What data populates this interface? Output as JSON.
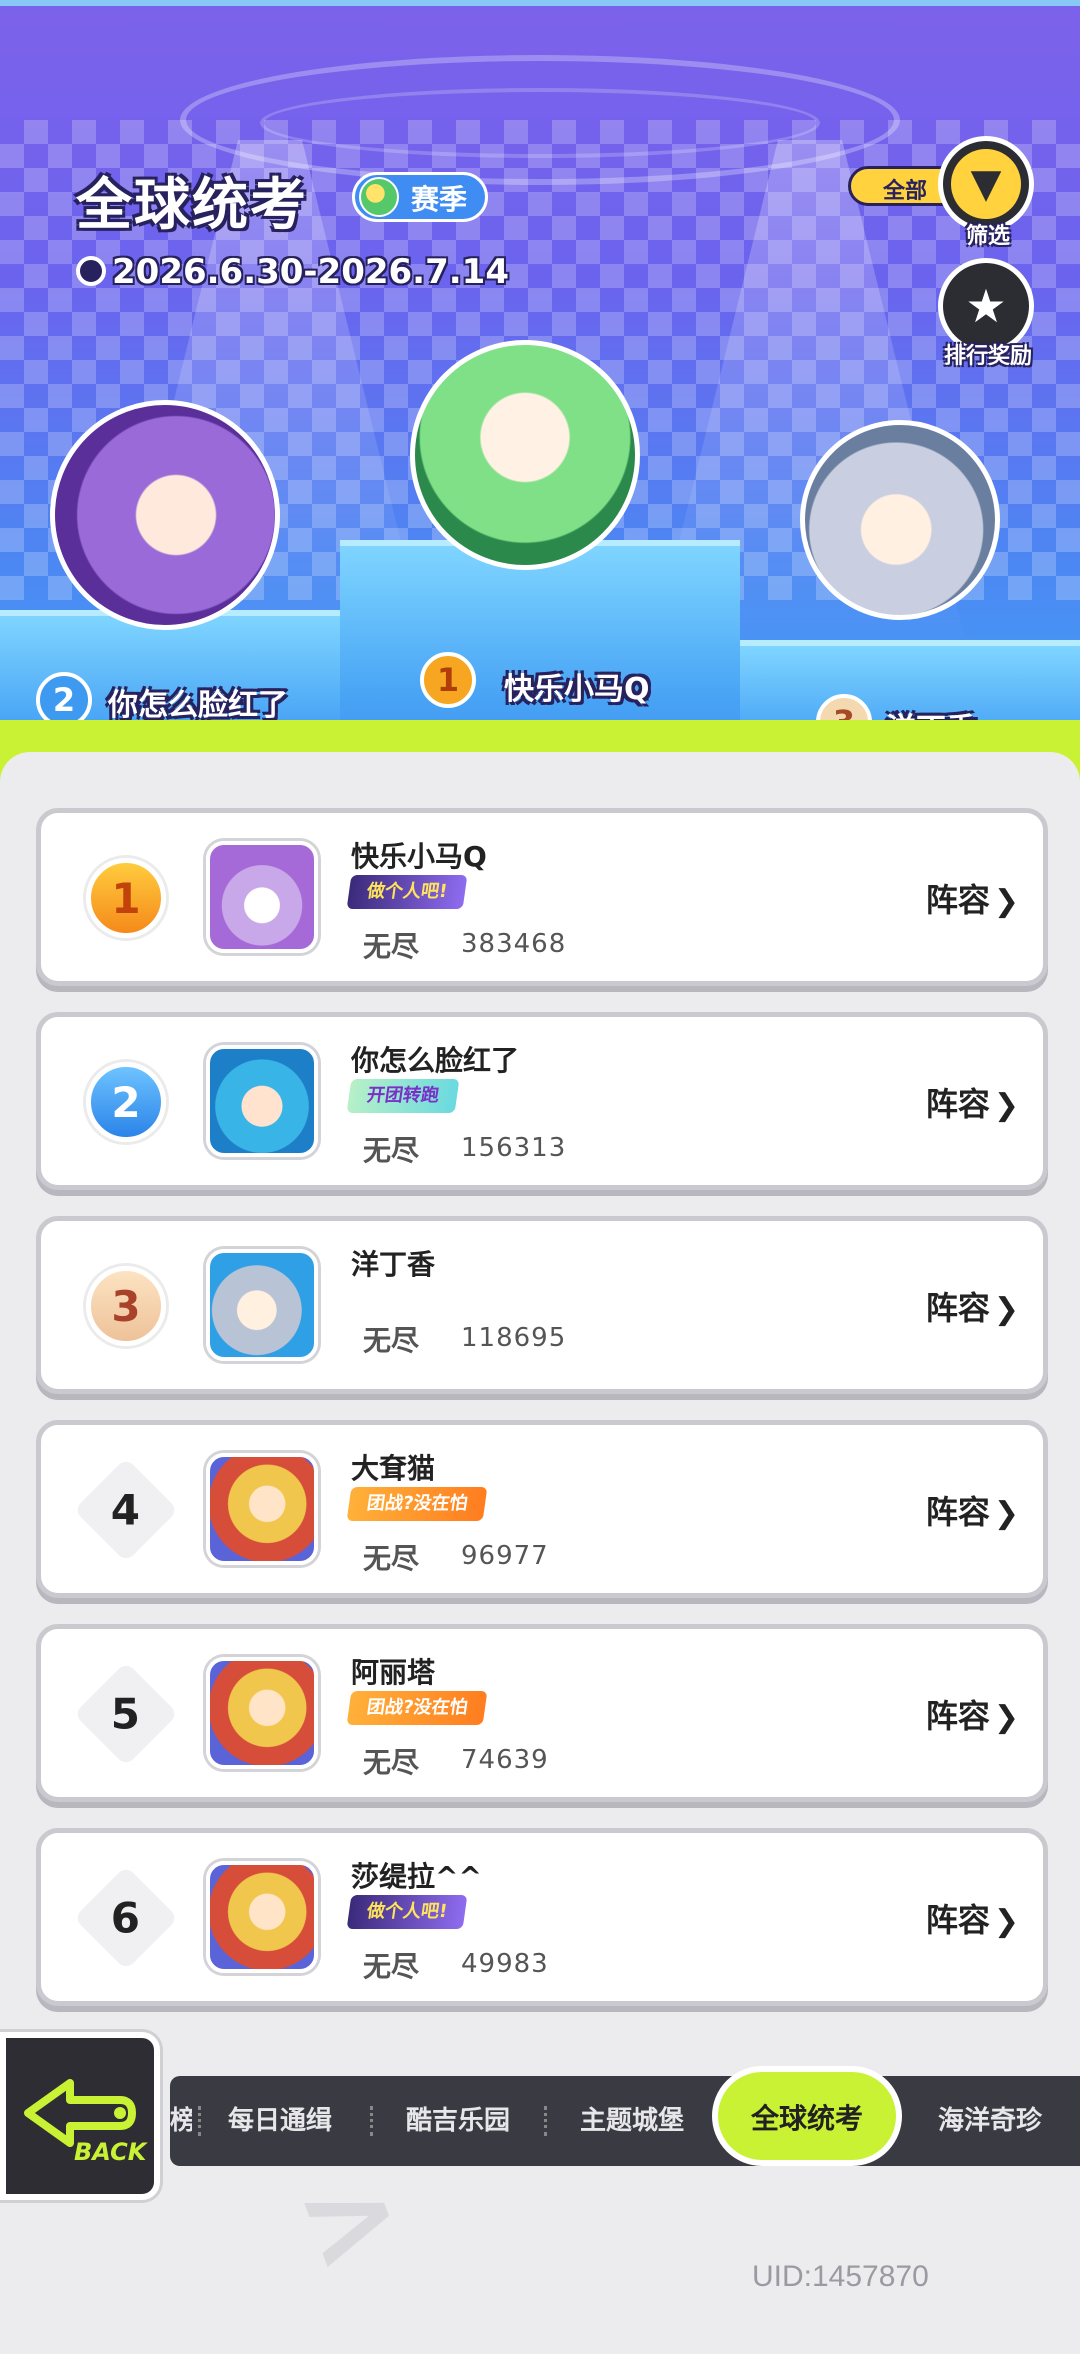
{
  "header": {
    "title": "全球统考",
    "season_badge": "赛季",
    "date_range": "2026.6.30-2026.7.14",
    "filter_value": "全部",
    "filter_label": "筛选",
    "reward_label": "排行奖励"
  },
  "podium": [
    {
      "rank": "1",
      "name": "快乐小马Q"
    },
    {
      "rank": "2",
      "name": "你怎么脸红了"
    },
    {
      "rank": "3",
      "name": "洋丁香"
    }
  ],
  "ranking": [
    {
      "rank": "1",
      "name": "快乐小马Q",
      "title": "做个人吧!",
      "mode": "无尽",
      "score": "383468",
      "lineup": "阵容"
    },
    {
      "rank": "2",
      "name": "你怎么脸红了",
      "title": "开团转跑",
      "mode": "无尽",
      "score": "156313",
      "lineup": "阵容"
    },
    {
      "rank": "3",
      "name": "洋丁香",
      "title": "",
      "mode": "无尽",
      "score": "118695",
      "lineup": "阵容"
    },
    {
      "rank": "4",
      "name": "大耷猫",
      "title": "团战?没在怕",
      "mode": "无尽",
      "score": "96977",
      "lineup": "阵容"
    },
    {
      "rank": "5",
      "name": "阿丽塔",
      "title": "团战?没在怕",
      "mode": "无尽",
      "score": "74639",
      "lineup": "阵容"
    },
    {
      "rank": "6",
      "name": "莎缇拉^^",
      "title": "做个人吧!",
      "mode": "无尽",
      "score": "49983",
      "lineup": "阵容"
    }
  ],
  "nav": {
    "back_label": "BACK",
    "tabs": [
      "榜",
      "每日通缉",
      "酷吉乐园",
      "主题城堡",
      "全球统考",
      "海洋奇珍"
    ],
    "active_tab": "全球统考"
  },
  "footer": {
    "uid": "UID:1457870"
  },
  "colors": {
    "accent": "#caf235",
    "gold": "#f6a621",
    "header": "#6b63ee"
  }
}
